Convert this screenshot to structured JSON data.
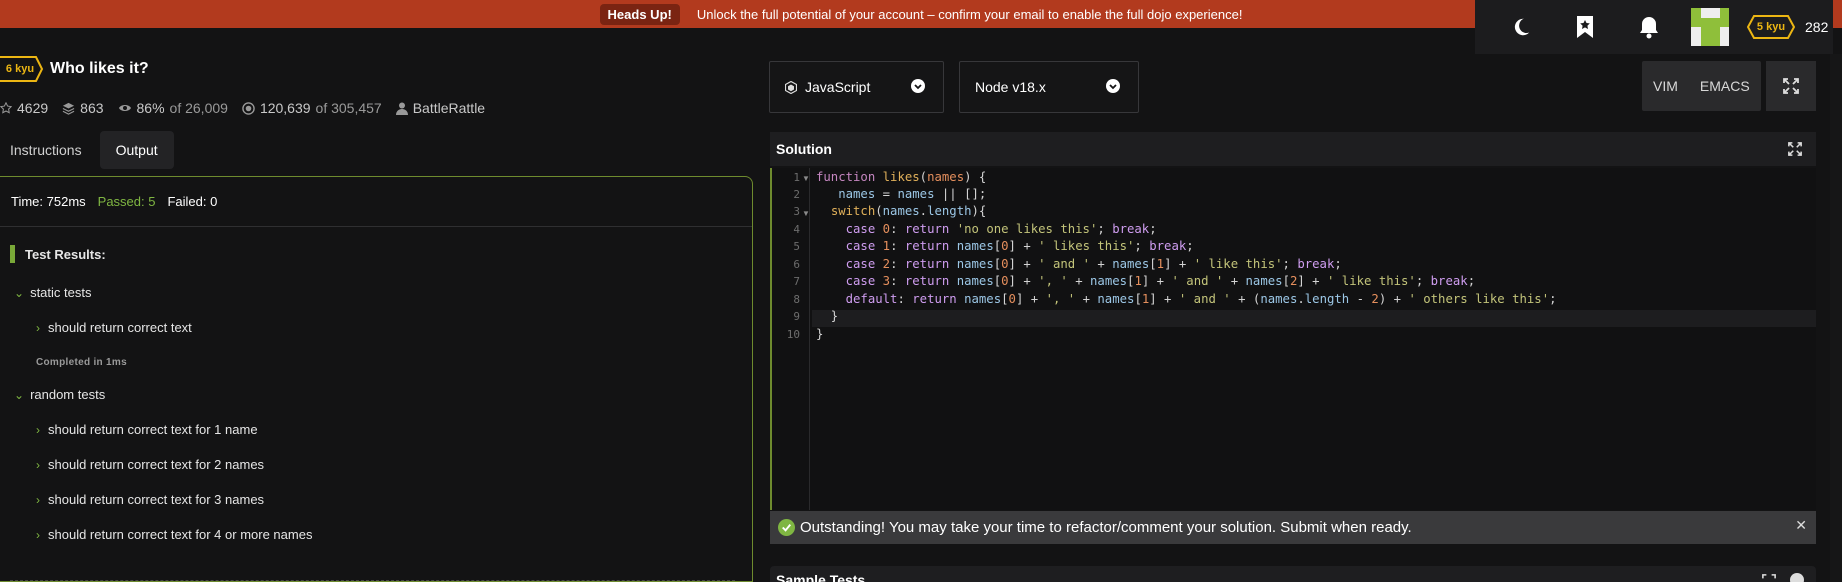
{
  "banner": {
    "badge": "Heads Up!",
    "message": "Unlock the full potential of your account – confirm your email to enable the full dojo experience!"
  },
  "user": {
    "rank": "5 kyu",
    "honor": "282"
  },
  "kata": {
    "rank": "6 kyu",
    "title": "Who likes it?",
    "stats": {
      "stars": "4629",
      "collections": "863",
      "satisfaction": "86%",
      "satisfaction_of": "of 26,009",
      "completed": "120,639",
      "completed_of": "of 305,457",
      "author": "BattleRattle"
    }
  },
  "tabs": [
    {
      "label": "Instructions",
      "active": false
    },
    {
      "label": "Output",
      "active": true
    }
  ],
  "output": {
    "time": "Time: 752ms",
    "passed": "Passed: 5",
    "failed": "Failed: 0",
    "results_title": "Test Results:",
    "groups": [
      {
        "label": "static tests",
        "items": [
          "should return correct text"
        ],
        "completed": "Completed in 1ms"
      },
      {
        "label": "random tests",
        "items": [
          "should return correct text for 1 name",
          "should return correct text for 2 names",
          "should return correct text for 3 names",
          "should return correct text for 4 or more names"
        ]
      }
    ]
  },
  "language": {
    "selected": "JavaScript"
  },
  "version": {
    "selected": "Node v18.x"
  },
  "modes": {
    "vim": "VIM",
    "emacs": "EMACS"
  },
  "solution": {
    "title": "Solution",
    "line_numbers": [
      "1",
      "2",
      "3",
      "4",
      "5",
      "6",
      "7",
      "8",
      "9",
      "10"
    ]
  },
  "success_message": "Outstanding! You may take your time to refactor/comment your solution. Submit when ready.",
  "sample_tests": {
    "title": "Sample Tests"
  },
  "colors": {
    "banner": "#b23a1e",
    "accent_green": "#7fb642",
    "kyu_yellow": "#ecb613",
    "background": "#131314"
  }
}
